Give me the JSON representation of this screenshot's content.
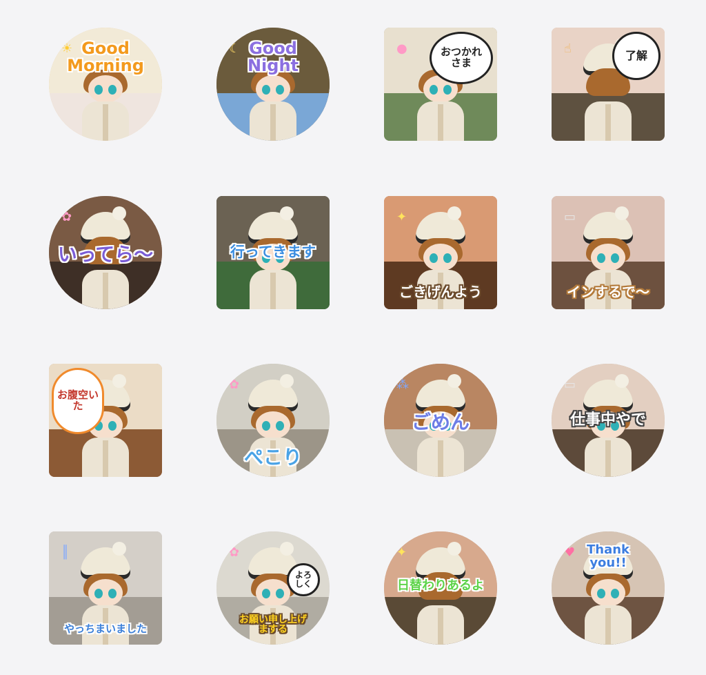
{
  "stickers": [
    {
      "caption": "Good\nMorning",
      "shape": "circle",
      "bg": "#e6c58f",
      "wall": "#f2ead7",
      "floor": "#efe5df",
      "textColor": "#f39a1e",
      "stroke": "#ffffff",
      "pos": "top",
      "size": 24,
      "doll": "no-hat",
      "icons": [
        "sun-icon"
      ]
    },
    {
      "caption": "Good\nNight",
      "shape": "circle",
      "bg": "#5b4a36",
      "wall": "#6b5b3c",
      "floor": "#7aa7d6",
      "textColor": "#8b6fe0",
      "stroke": "#ffffff",
      "pos": "top",
      "size": 24,
      "doll": "no-hat",
      "icons": [
        "moon-icon"
      ]
    },
    {
      "caption": "",
      "bubble": "おつかれ\nさま",
      "shape": "square",
      "bg": "#9c8e74",
      "wall": "#e8e0cf",
      "floor": "#6f8a5a",
      "doll": "no-hat",
      "icons": [
        "pink-dots-icon"
      ]
    },
    {
      "caption": "",
      "bubble": "了解",
      "shape": "square",
      "bg": "#d7b399",
      "wall": "#e9d3c6",
      "floor": "#5e5140",
      "doll": "back",
      "icons": [
        "thumbs-up-icon"
      ]
    },
    {
      "caption": "いってら〜",
      "shape": "circle",
      "bg": "#6a4e3b",
      "wall": "#7a5a44",
      "floor": "#3e2f26",
      "textColor": "#7a5cd6",
      "stroke": "#ffffff",
      "pos": "mid",
      "size": 28,
      "doll": "back",
      "icons": [
        "flower-icon"
      ]
    },
    {
      "caption": "行ってきます",
      "shape": "square",
      "bg": "#4d4a40",
      "wall": "#6b6253",
      "floor": "#3f6b3b",
      "textColor": "#3b8de0",
      "stroke": "#ffffff",
      "pos": "mid",
      "size": 21,
      "doll": "normal",
      "icons": []
    },
    {
      "caption": "ごきげんよう",
      "shape": "square",
      "bg": "#b56f43",
      "wall": "#d99a73",
      "floor": "#5e3a22",
      "textColor": "#ffffff",
      "stroke": "#6b4a2b",
      "pos": "bottom",
      "size": 20,
      "doll": "normal",
      "icons": [
        "sparkle-icon"
      ]
    },
    {
      "caption": "インするで〜",
      "shape": "square",
      "bg": "#c9a994",
      "wall": "#dcc1b5",
      "floor": "#6d513f",
      "textColor": "#ffffff",
      "stroke": "#b37a3a",
      "pos": "bottom",
      "size": 20,
      "doll": "normal",
      "icons": [
        "monitor-icon"
      ]
    },
    {
      "caption": "",
      "bubble": "お腹空いた",
      "shape": "square",
      "bg": "#c49a6c",
      "wall": "#ebdcc6",
      "floor": "#8c5a35",
      "doll": "normal",
      "icons": [
        "ramen-icon"
      ]
    },
    {
      "caption": "ぺこり",
      "shape": "circle",
      "bg": "#b7b3a6",
      "wall": "#d2cfc5",
      "floor": "#9c9588",
      "textColor": "#4aa3e6",
      "stroke": "#ffffff",
      "pos": "bottom",
      "size": 28,
      "doll": "normal",
      "icons": [
        "flower-icon"
      ]
    },
    {
      "caption": "ごめん",
      "shape": "circle",
      "bg": "#8f5a3a",
      "wall": "#b98662",
      "floor": "#c9c1b3",
      "textColor": "#6d7de6",
      "stroke": "#ffffff",
      "pos": "mid",
      "size": 28,
      "doll": "normal",
      "icons": [
        "tear-icon"
      ]
    },
    {
      "caption": "仕事中やで",
      "shape": "circle",
      "bg": "#c1a98f",
      "wall": "#e3cfc1",
      "floor": "#5d4a3a",
      "textColor": "#ffffff",
      "stroke": "#444444",
      "pos": "mid",
      "size": 22,
      "doll": "normal",
      "icons": [
        "monitor-icon"
      ]
    },
    {
      "caption": "やっちまいました",
      "shape": "square",
      "bg": "#bdb7ae",
      "wall": "#d4cfc8",
      "floor": "#a39d94",
      "textColor": "#3b7fd8",
      "stroke": "#ffffff",
      "pos": "bottom",
      "size": 15,
      "doll": "normal",
      "icons": [
        "lines-icon"
      ]
    },
    {
      "caption": "お願い申し上げ\nまする",
      "shape": "circle",
      "bg": "#c7c4bb",
      "wall": "#dcd9d0",
      "floor": "#b0aca2",
      "textColor": "#ffd21f",
      "stroke": "#6a4a2a",
      "pos": "bottom",
      "size": 14,
      "doll": "normal",
      "bubble2": "よろ\nしく",
      "icons": [
        "flower-icon"
      ]
    },
    {
      "caption": "日替わりあるよ",
      "shape": "circle",
      "bg": "#bb8e6f",
      "wall": "#d7a98d",
      "floor": "#5a4a36",
      "textColor": "#5ed34a",
      "stroke": "#ffffff",
      "pos": "mid",
      "size": 18,
      "doll": "back",
      "icons": [
        "sparkle-icon"
      ]
    },
    {
      "caption": "Thank\nyou!!",
      "shape": "circle",
      "bg": "#b39f8a",
      "wall": "#d6c4b4",
      "floor": "#6e5442",
      "textColor": "#3d7ee0",
      "stroke": "#ffffff",
      "pos": "top",
      "size": 18,
      "doll": "normal",
      "icons": [
        "heart-icon"
      ]
    }
  ]
}
